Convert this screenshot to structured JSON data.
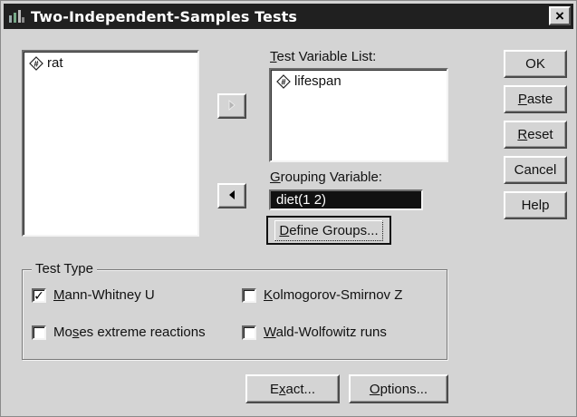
{
  "window": {
    "title": "Two-Independent-Samples Tests",
    "close_glyph": "×"
  },
  "source_list": {
    "items": [
      {
        "label": "rat",
        "icon": "numeric-variable-icon"
      }
    ]
  },
  "test_variable_list": {
    "label_u": "T",
    "label_rest": "est Variable List:",
    "items": [
      {
        "label": "lifespan",
        "icon": "numeric-variable-icon"
      }
    ]
  },
  "grouping": {
    "label_u": "G",
    "label_rest": "rouping Variable:",
    "value": "diet(1 2)",
    "define_u": "D",
    "define_rest": "efine Groups..."
  },
  "buttons": {
    "ok": "OK",
    "paste_u": "P",
    "paste_rest": "aste",
    "reset_u": "R",
    "reset_rest": "eset",
    "cancel": "Cancel",
    "help": "Help",
    "exact_pre": "E",
    "exact_u": "x",
    "exact_rest": "act...",
    "options_u": "O",
    "options_rest": "ptions..."
  },
  "test_type": {
    "legend": "Test Type",
    "mann_whitney": {
      "pre": "",
      "u": "M",
      "rest": "ann-Whitney U",
      "checked": true
    },
    "moses": {
      "pre": "Mo",
      "u": "s",
      "rest": "es extreme reactions",
      "checked": false
    },
    "kolmogorov": {
      "pre": "",
      "u": "K",
      "rest": "olmogorov-Smirnov Z",
      "checked": false
    },
    "wald": {
      "pre": "",
      "u": "W",
      "rest": "ald-Wolfowitz runs",
      "checked": false
    }
  }
}
